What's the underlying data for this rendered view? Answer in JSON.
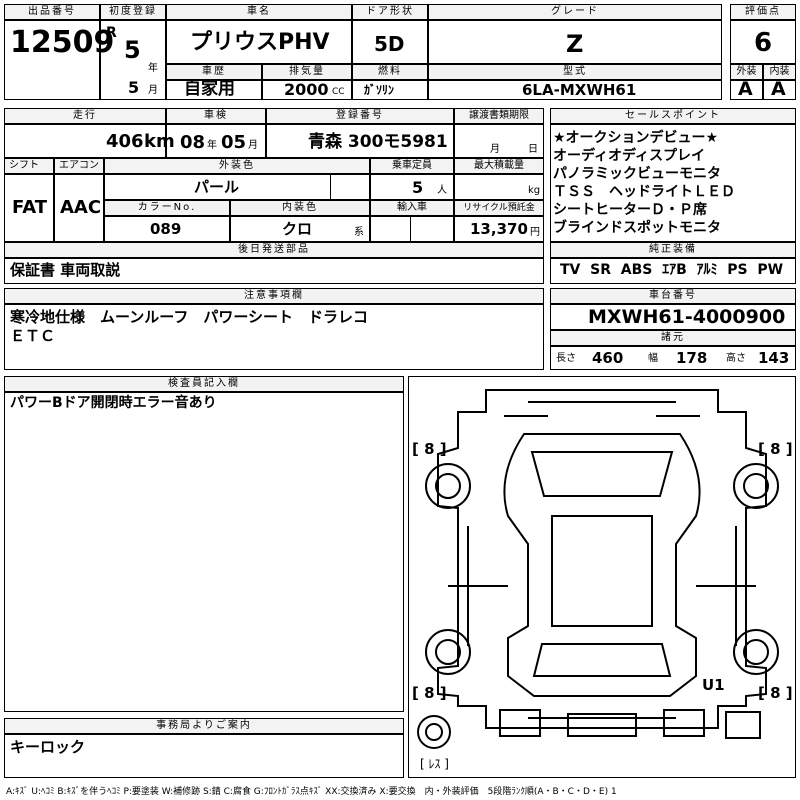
{
  "lot": {
    "label": "出品番号",
    "value": "12509"
  },
  "first_reg": {
    "label": "初度登録",
    "era": "R",
    "year": "5",
    "year_unit": "年",
    "month": "5",
    "month_unit": "月"
  },
  "car_name": {
    "label": "車名",
    "value": "プリウスPHV"
  },
  "door": {
    "label": "ドア形状",
    "value": "5D"
  },
  "grade": {
    "label": "グレード",
    "value": "Z"
  },
  "score": {
    "label": "評価点",
    "value": "6"
  },
  "history": {
    "label": "車歴",
    "value": "自家用"
  },
  "displacement": {
    "label": "排気量",
    "value": "2000",
    "unit": "CC"
  },
  "fuel": {
    "label": "燃料",
    "value": "ｶﾞｿﾘﾝ"
  },
  "model": {
    "label": "型式",
    "value": "6LA-MXWH61"
  },
  "exterior_grade": {
    "label": "外装",
    "value": "A"
  },
  "interior_grade": {
    "label": "内装",
    "value": "A"
  },
  "mileage": {
    "label": "走行",
    "value": "406",
    "unit": "km"
  },
  "inspection": {
    "label": "車検",
    "year": "08",
    "year_unit": "年",
    "month": "05",
    "month_unit": "月"
  },
  "plate": {
    "label": "登録番号",
    "value": "青森 300モ5981"
  },
  "transfer_deadline": {
    "label": "譲渡書類期限",
    "month_unit": "月",
    "day_unit": "日"
  },
  "shift": {
    "label": "シフト",
    "value": "FAT"
  },
  "aircon": {
    "label": "エアコン",
    "value": "AAC"
  },
  "ext_color": {
    "label": "外装色",
    "value": "パール"
  },
  "capacity": {
    "label": "乗車定員",
    "value": "5",
    "unit": "人"
  },
  "max_load": {
    "label": "最大積載量",
    "unit": "kg"
  },
  "color_no": {
    "label": "カラーNo.",
    "value": "089"
  },
  "int_color": {
    "label": "内装色",
    "value": "クロ",
    "unit": "系"
  },
  "import": {
    "label": "輸入車"
  },
  "recycle": {
    "label": "リサイクル預託金",
    "value": "13,370",
    "unit": "円"
  },
  "later_parts": {
    "label": "後日発送部品",
    "value": "保証書 車両取説"
  },
  "sales_points": {
    "label": "セールスポイント",
    "lines": [
      "★オークションデビュー★",
      "オーディオディスプレイ",
      "パノラミックビューモニタ",
      "ＴＳＳ　ヘッドライトＬＥＤ",
      "シートヒーターＤ・Ｐ席",
      "ブラインドスポットモニタ"
    ]
  },
  "equipment": {
    "label": "純正装備",
    "value": "TV  SR  ABS  ｴｱB  ｱﾙﾐ  PS  PW"
  },
  "notes": {
    "label": "注意事項欄",
    "line1": "寒冷地仕様　ムーンルーフ　パワーシート　ドラレコ",
    "line2": "ＥＴＣ"
  },
  "chassis": {
    "label": "車台番号",
    "value": "MXWH61-4000900"
  },
  "specs": {
    "label": "諸元",
    "length_label": "長さ",
    "length": "460",
    "width_label": "幅",
    "width": "178",
    "height_label": "高さ",
    "height": "143"
  },
  "inspector": {
    "label": "検査員記入欄",
    "value": "パワーBドア開閉時エラー音あり"
  },
  "diagram": {
    "tire_fl": "[ 8 ]",
    "tire_fr": "[ 8 ]",
    "tire_rl": "[ 8 ]",
    "tire_rr": "[ 8 ]",
    "mark": "U1",
    "spare": "[ ﾚｽ ]"
  },
  "office": {
    "label": "事務局よりご案内",
    "value": "キーロック"
  },
  "legend": "A:ｷｽﾞ U:ﾍｺﾐ B:ｷｽﾞを伴うﾍｺﾐ P:要塗装 W:補修跡 S:錆 C:腐食 G:ﾌﾛﾝﾄｶﾞﾗｽ点ｷｽﾞ XX:交換済み X:要交換　内・外装評価　5段階ﾗﾝｸ順(A・B・C・D・E) 1"
}
